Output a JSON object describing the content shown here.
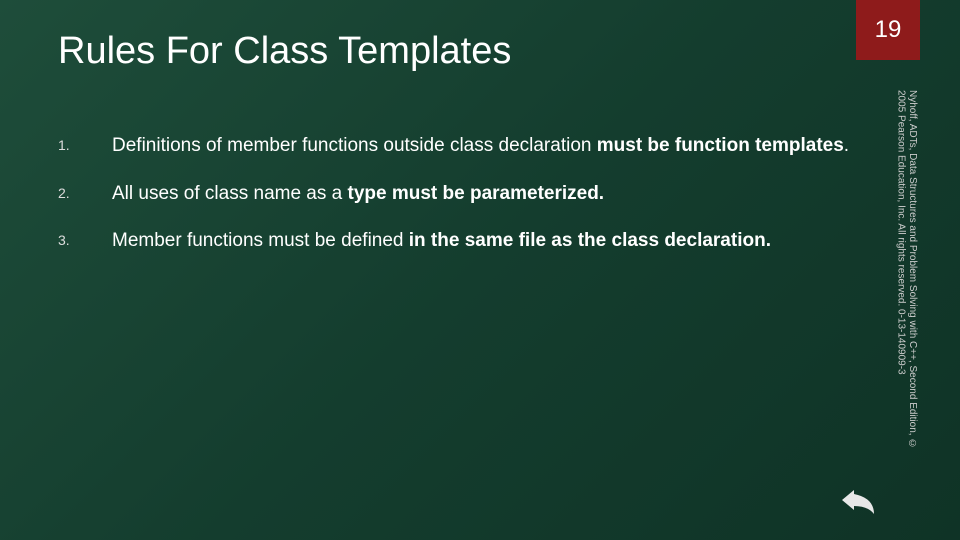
{
  "header": {
    "title": "Rules For Class Templates",
    "page_number": "19"
  },
  "rules": [
    {
      "num": "1.",
      "text_a": "Definitions of member functions outside class declaration ",
      "text_b": "must be function templates",
      "text_c": "."
    },
    {
      "num": "2.",
      "text_a": "All uses of class name as a ",
      "text_b": "type must be parameterized.",
      "text_c": ""
    },
    {
      "num": "3.",
      "text_a": "Member functions must be defined ",
      "text_b": "in the same file as the class declaration.",
      "text_c": ""
    }
  ],
  "sidebar": {
    "citation": "Nyhoff, ADTs, Data Structures and Problem Solving with C++, Second Edition, © 2005 Pearson Education, Inc. All rights reserved. 0-13-140909-3"
  }
}
